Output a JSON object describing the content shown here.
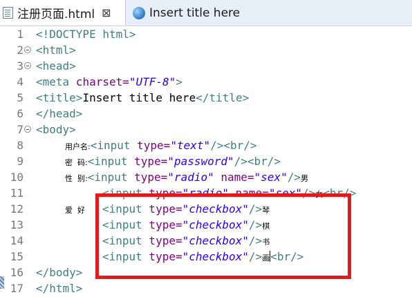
{
  "tabs": [
    {
      "label": "注册页面.html",
      "close": "⊠"
    },
    {
      "label": "Insert title here"
    }
  ],
  "editor": {
    "lines": [
      {
        "n": "1",
        "t": [
          "<!DOCTYPE html>"
        ]
      },
      {
        "n": "2",
        "t": [
          "<html>"
        ]
      },
      {
        "n": "3",
        "t": [
          "<head>"
        ]
      },
      {
        "n": "4",
        "t": [
          "<meta",
          " charset=",
          "\"UTF-8\"",
          ">"
        ]
      },
      {
        "n": "5",
        "t": [
          "<title>",
          "Insert title here",
          "</title>"
        ]
      },
      {
        "n": "6",
        "t": [
          "</head>"
        ]
      },
      {
        "n": "7",
        "t": [
          "<body>"
        ]
      },
      {
        "n": "8",
        "t": [
          "用户名:",
          "<input",
          " type=",
          "\"text\"",
          "/>",
          "<br/>"
        ]
      },
      {
        "n": "9",
        "t": [
          "密  码:",
          "<input",
          " type=",
          "\"password\"",
          "/>",
          "<br/>"
        ]
      },
      {
        "n": "10",
        "t": [
          "性  别:",
          "<input",
          " type=",
          "\"radio\"",
          " name=",
          "\"sex\"",
          "/>",
          "男"
        ]
      },
      {
        "n": "11",
        "t": [
          "<input",
          " type=",
          "\"radio\"",
          " name=",
          "\"sex\"",
          "/>",
          "女",
          "<br/>"
        ]
      },
      {
        "n": "12",
        "t": [
          "爱  好",
          "<input",
          " type=",
          "\"checkbox\"",
          "/>",
          "琴"
        ]
      },
      {
        "n": "13",
        "t": [
          "<input",
          " type=",
          "\"checkbox\"",
          "/>",
          "棋"
        ]
      },
      {
        "n": "14",
        "t": [
          "<input",
          " type=",
          "\"checkbox\"",
          "/>",
          "书"
        ]
      },
      {
        "n": "15",
        "t": [
          "<input",
          " type=",
          "\"checkbox\"",
          "/>",
          "画",
          "<br/>"
        ]
      },
      {
        "n": "16",
        "t": [
          "</body>"
        ]
      },
      {
        "n": "17",
        "t": [
          "</html>"
        ]
      }
    ]
  },
  "colors": {
    "tag": "#3f7f7f",
    "attribute": "#7f007f",
    "value": "#2a00ff",
    "highlight": "#e21c1c"
  }
}
